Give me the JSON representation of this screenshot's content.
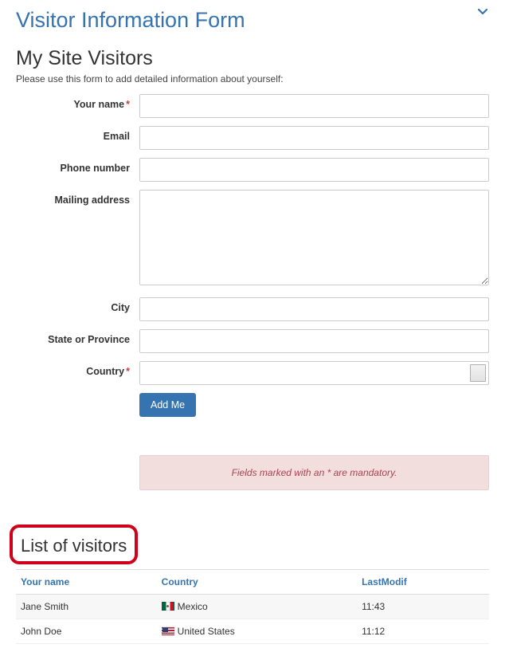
{
  "header": {
    "page_title": "Visitor Information Form"
  },
  "form": {
    "heading": "My Site Visitors",
    "instruction": "Please use this form to add detailed information about yourself:",
    "labels": {
      "name": "Your name",
      "email": "Email",
      "phone": "Phone number",
      "address": "Mailing address",
      "city": "City",
      "state": "State or Province",
      "country": "Country"
    },
    "values": {
      "name": "",
      "email": "",
      "phone": "",
      "address": "",
      "city": "",
      "state": "",
      "country": ""
    },
    "submit_label": "Add Me",
    "mandatory_note": "Fields marked with an * are mandatory."
  },
  "visitor_list": {
    "heading": "List of visitors",
    "columns": {
      "name": "Your name",
      "country": "Country",
      "lastmodif": "LastModif"
    },
    "rows": [
      {
        "name": "Jane Smith",
        "country": "Mexico",
        "flag": "mx",
        "lastmodif": "11:43"
      },
      {
        "name": "John Doe",
        "country": "United States",
        "flag": "us",
        "lastmodif": "11:12"
      }
    ]
  }
}
